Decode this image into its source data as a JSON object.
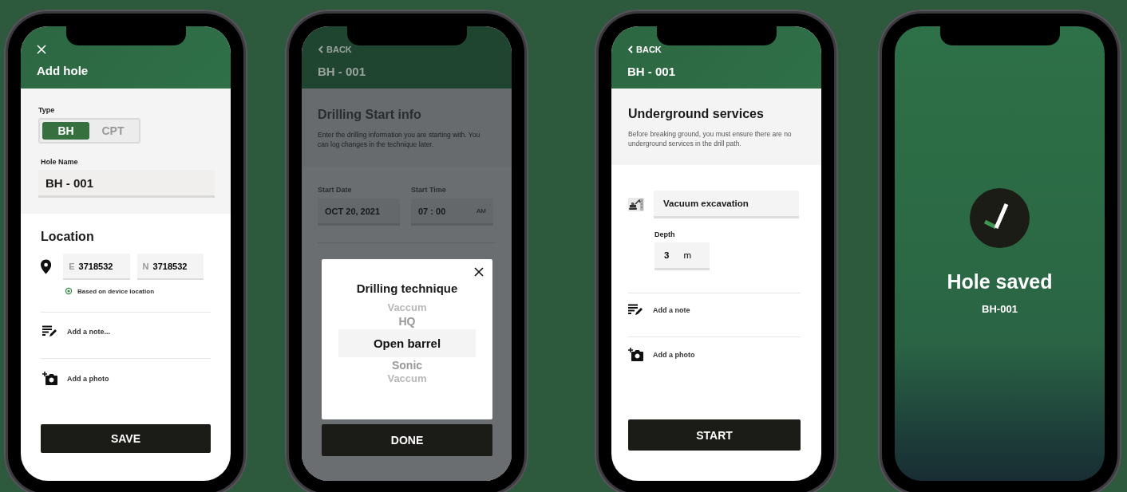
{
  "screens": [
    {
      "kind": "form",
      "title": "Add hole",
      "type_label": "Type",
      "type_options": [
        {
          "label": "BH",
          "selected": true
        },
        {
          "label": "CPT",
          "selected": false
        }
      ],
      "hole_name_label": "Hole Name",
      "hole_name_value": "BH - 001",
      "location_title": "Location",
      "easting": {
        "prefix": "E",
        "value": "3718532"
      },
      "northing": {
        "prefix": "N",
        "value": "3718532"
      },
      "location_hint": "Based on device location",
      "note": "Add a note...",
      "photo": "Add a photo",
      "button": "SAVE"
    },
    {
      "kind": "picker",
      "back": "BACK",
      "title": "BH - 001",
      "section_title": "Drilling Start info",
      "description": "Enter the drilling information you are starting with. You can log changes in the technique later.",
      "start_date": {
        "label": "Start Date",
        "value": "OCT 20, 2021"
      },
      "start_time": {
        "label": "Start Time",
        "value": "07 : 00",
        "suffix": "AM"
      },
      "dialog": {
        "title": "Drilling technique",
        "options": [
          {
            "label": "Vaccum",
            "selected": false
          },
          {
            "label": "HQ",
            "selected": false
          },
          {
            "label": "Open barrel",
            "selected": true
          },
          {
            "label": "Sonic",
            "selected": false
          },
          {
            "label": "Vaccum",
            "selected": false
          }
        ]
      },
      "button": "DONE"
    },
    {
      "kind": "services",
      "back": "BACK",
      "title": "BH - 001",
      "section_title": "Underground services",
      "description": "Before breaking ground, you must ensure there are no underground services in the drill path.",
      "method": "Vacuum excavation",
      "depth": {
        "label": "Depth",
        "value": "3",
        "unit": "m"
      },
      "note": "Add a note",
      "photo": "Add a photo",
      "button": "START"
    },
    {
      "kind": "success",
      "title": "Hole saved",
      "subtitle": "BH-001"
    }
  ]
}
